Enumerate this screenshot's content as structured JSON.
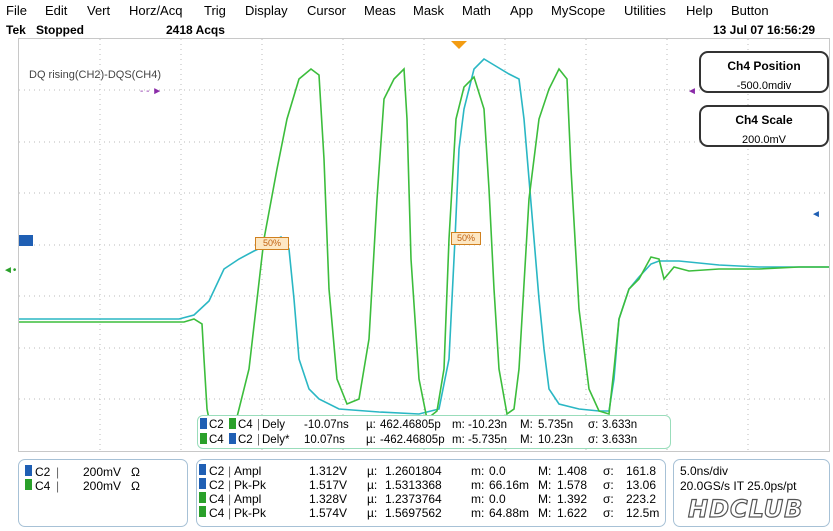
{
  "menu": [
    "File",
    "Edit",
    "Vert",
    "Horz/Acq",
    "Trig",
    "Display",
    "Cursor",
    "Meas",
    "Mask",
    "Math",
    "App",
    "MyScope",
    "Utilities",
    "Help",
    "Button"
  ],
  "status": {
    "brand": "Tek",
    "state": "Stopped",
    "acqs": "2418 Acqs",
    "datetime": "13 Jul 07 16:56:29"
  },
  "waveform_label": "DQ rising(CH2)-DQS(CH4)",
  "ch4_position": {
    "title": "Ch4 Position",
    "value": "-500.0mdiv"
  },
  "ch4_scale": {
    "title": "Ch4 Scale",
    "value": "200.0mV"
  },
  "markers": {
    "ref_level_left": "50%",
    "ref_level_right": "50%"
  },
  "overlay_meas": [
    {
      "a": "C2",
      "b": "C4",
      "name": "Dely",
      "value": "-10.07ns",
      "mu_label": "µ:",
      "mu": "462.46805p",
      "m_label": "m:",
      "m": "-10.23n",
      "M_label": "M:",
      "M": "5.735n",
      "s_label": "σ:",
      "s": "3.633n",
      "acolor": "#1f5fb4",
      "bcolor": "#2aa02a"
    },
    {
      "a": "C4",
      "b": "C2",
      "name": "Dely*",
      "value": "10.07ns",
      "mu_label": "µ:",
      "mu": "-462.46805p",
      "m_label": "m:",
      "m": "-5.735n",
      "M_label": "M:",
      "M": "10.23n",
      "s_label": "σ:",
      "s": "3.633n",
      "acolor": "#2aa02a",
      "bcolor": "#1f5fb4"
    }
  ],
  "channels": [
    {
      "name": "C2",
      "scale": "200mV",
      "imp": "Ω",
      "color": "#1f5fb4"
    },
    {
      "name": "C4",
      "scale": "200mV",
      "imp": "Ω",
      "color": "#2aa02a"
    }
  ],
  "measurements": [
    {
      "ch": "C2",
      "name": "Ampl",
      "value": "1.312V",
      "mu_label": "µ:",
      "mu": "1.2601804",
      "m_label": "m:",
      "m": "0.0",
      "M_label": "M:",
      "M": "1.408",
      "s_label": "σ:",
      "s": "161.8",
      "color": "#1f5fb4"
    },
    {
      "ch": "C2",
      "name": "Pk-Pk",
      "value": "1.517V",
      "mu_label": "µ:",
      "mu": "1.5313368",
      "m_label": "m:",
      "m": "66.16m",
      "M_label": "M:",
      "M": "1.578",
      "s_label": "σ:",
      "s": "13.06",
      "color": "#1f5fb4"
    },
    {
      "ch": "C4",
      "name": "Ampl",
      "value": "1.328V",
      "mu_label": "µ:",
      "mu": "1.2373764",
      "m_label": "m:",
      "m": "0.0",
      "M_label": "M:",
      "M": "1.392",
      "s_label": "σ:",
      "s": "223.2",
      "color": "#2aa02a"
    },
    {
      "ch": "C4",
      "name": "Pk-Pk",
      "value": "1.574V",
      "mu_label": "µ:",
      "mu": "1.5697562",
      "m_label": "m:",
      "m": "64.88m",
      "M_label": "M:",
      "M": "1.622",
      "s_label": "σ:",
      "s": "12.5m",
      "color": "#2aa02a"
    }
  ],
  "timebase": {
    "div": "5.0ns/div",
    "rate": "20.0GS/s IT 25.0ps/pt"
  },
  "watermark": "HDCLUB"
}
